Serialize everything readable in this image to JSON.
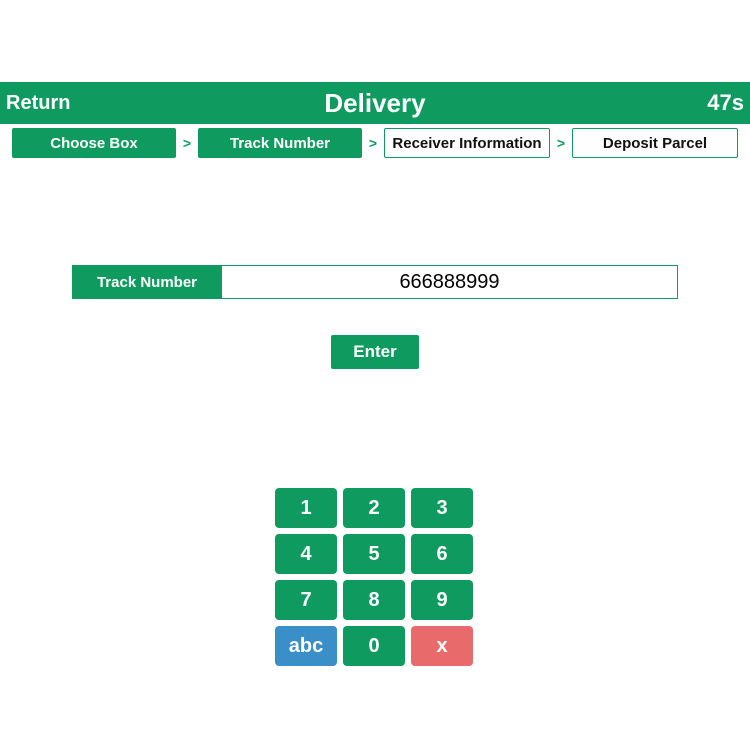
{
  "header": {
    "return_label": "Return",
    "title": "Delivery",
    "timer": "47s"
  },
  "breadcrumb": {
    "sep": ">",
    "steps": [
      {
        "label": "Choose Box",
        "style": "filled"
      },
      {
        "label": "Track Number",
        "style": "filled"
      },
      {
        "label": "Receiver Information",
        "style": "outline"
      },
      {
        "label": "Deposit Parcel",
        "style": "outline"
      }
    ]
  },
  "field": {
    "label": "Track Number",
    "value": "666888999"
  },
  "enter_label": "Enter",
  "keypad": {
    "keys": [
      "1",
      "2",
      "3",
      "4",
      "5",
      "6",
      "7",
      "8",
      "9",
      "abc",
      "0",
      "x"
    ]
  }
}
